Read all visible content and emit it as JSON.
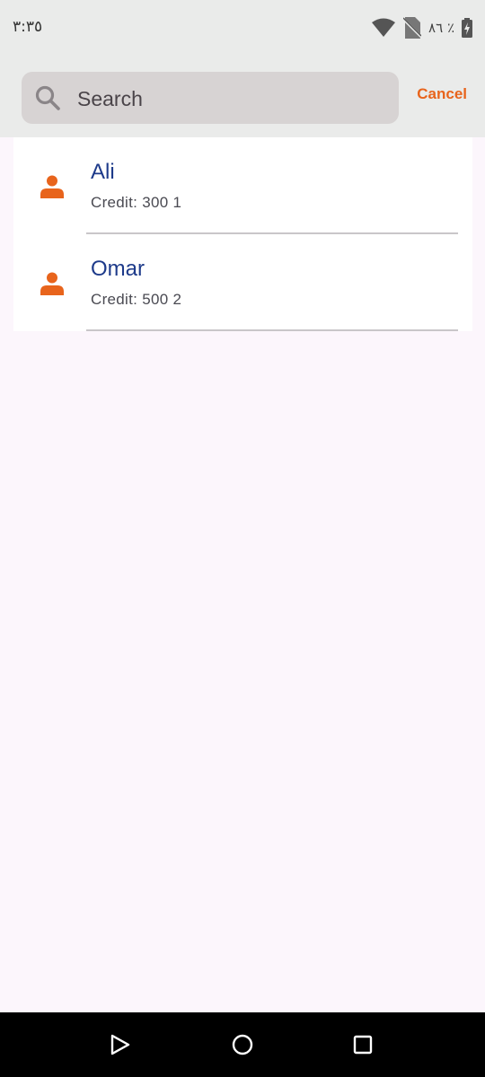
{
  "status_bar": {
    "time": "٣:٣٥",
    "battery_text": "٨٦ ٪",
    "icons": [
      "wifi-icon",
      "no-sim-icon",
      "battery-charging-icon"
    ]
  },
  "search": {
    "placeholder": "Search",
    "value": "",
    "cancel_label": "Cancel"
  },
  "contacts": [
    {
      "name": "Ali",
      "credit": "Credit: 300 1"
    },
    {
      "name": "Omar",
      "credit": "Credit: 500 2"
    }
  ],
  "navigation": {
    "buttons": [
      "back-icon",
      "home-icon",
      "recents-icon"
    ]
  },
  "colors": {
    "accent": "#e8641c",
    "name_text": "#1d3a8a",
    "header_bg": "#eaebea",
    "search_bg": "#d7d3d3",
    "page_bg": "#fcf6fc"
  }
}
